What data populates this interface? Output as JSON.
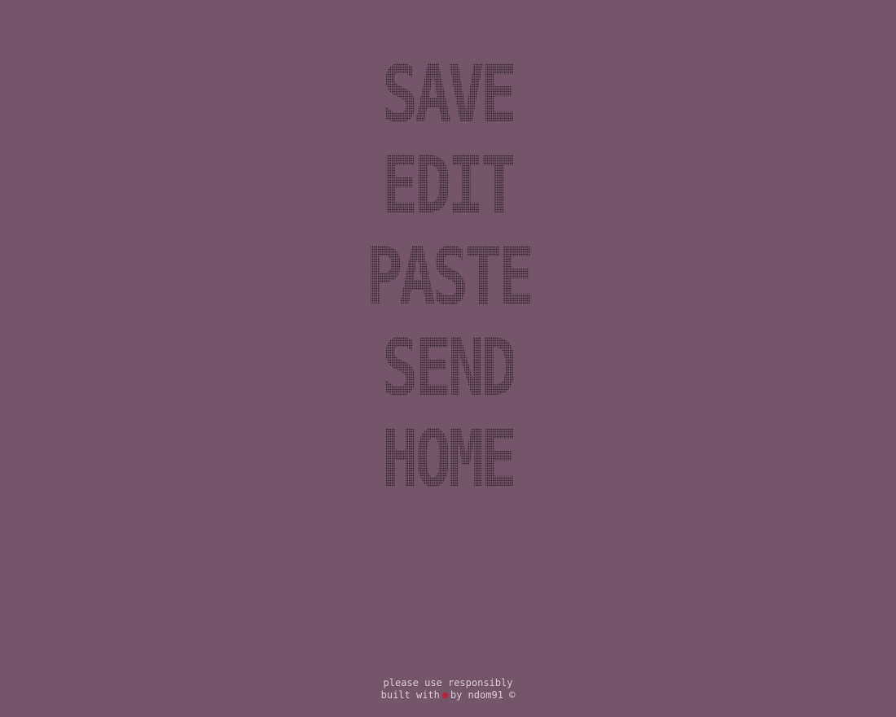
{
  "colors": {
    "background": "#74566b",
    "menu_text": "#2b1f28",
    "footer_text": "#d9ccd5",
    "heart": "#c0203a"
  },
  "menu": {
    "items": [
      {
        "label": "SAVE"
      },
      {
        "label": "EDIT"
      },
      {
        "label": "PASTE"
      },
      {
        "label": "SEND"
      },
      {
        "label": "HOME"
      }
    ]
  },
  "footer": {
    "line1": "please use responsibly",
    "built_with": "built with",
    "heart_icon": "heart-icon",
    "by": "by ndom91 ©"
  }
}
